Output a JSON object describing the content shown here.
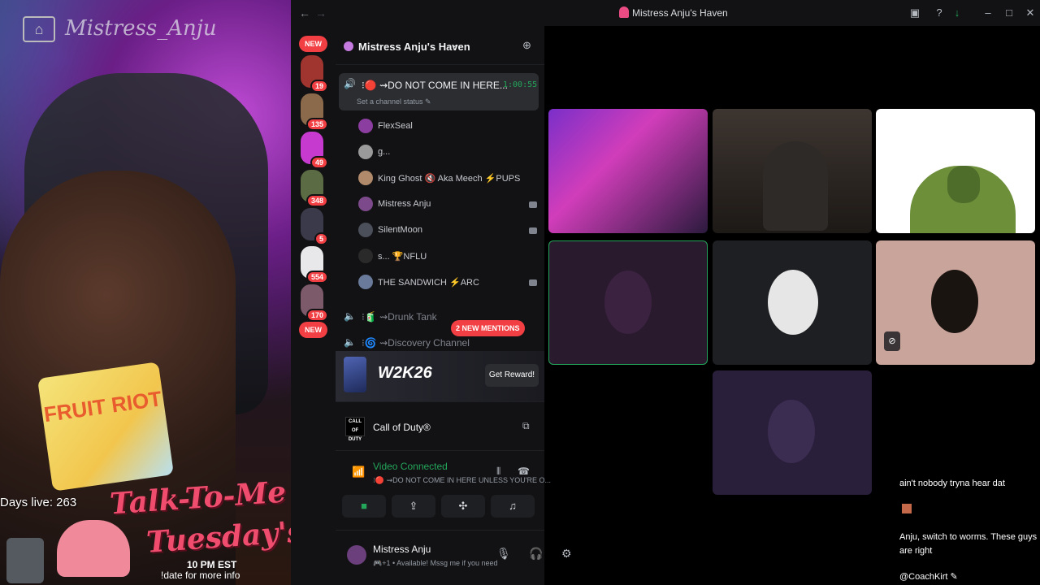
{
  "overlay": {
    "watermark": "Mistress_Anju",
    "days_live_label": "Days live: 263",
    "event_line1": "Talk-To-Me",
    "event_line2": "Tuesday's",
    "event_time": "10 PM EST",
    "event_cmd": "!date for more info",
    "chips_text": "FRUIT RIOT"
  },
  "titlebar": {
    "title": "Mistress Anju's Haven",
    "back_glyph": "←",
    "forward_glyph": "→"
  },
  "servers": [
    {
      "badge": "19",
      "color": "#a0352f"
    },
    {
      "badge": "135",
      "color": "#8b6a4c"
    },
    {
      "badge": "49",
      "color": "#c63ad0"
    },
    {
      "badge": "348",
      "color": "#5b6b44"
    },
    {
      "badge": "5",
      "color": "#3a3a4a"
    },
    {
      "badge": "554",
      "color": "#e8e8ea"
    },
    {
      "badge": "170",
      "color": "#7c5a6a"
    }
  ],
  "server_pills": {
    "new_top": "NEW",
    "new_bottom": "NEW"
  },
  "guild": {
    "name": "Mistress Anju's Haven",
    "chevron": "⌄"
  },
  "active_channel": {
    "name": "⁝🔴 ⇝DO NOT COME IN HERE...",
    "timer": "1:00:55",
    "status": "Set a channel status ✎"
  },
  "members": [
    {
      "name": "FlexSeal",
      "color": "#8b3da0"
    },
    {
      "name": "g...",
      "color": "#9a9a9a"
    },
    {
      "name": "King Ghost 🔇 Aka Meech ⚡PUPS",
      "color": "#b08a6a"
    },
    {
      "name": "Mistress Anju",
      "color": "#7c4a8a"
    },
    {
      "name": "SilentMoon",
      "color": "#4a4f5a"
    },
    {
      "name": "s... 🏆NFLU",
      "color": "#2a2a2a"
    },
    {
      "name": "THE SANDWICH ⚡ARC",
      "color": "#6a7a9a"
    }
  ],
  "other_channels": [
    {
      "name": "⁝🧃 ⇝Drunk Tank"
    },
    {
      "name": "⁝🌀 ⇝Discovery Channel"
    }
  ],
  "new_mentions": "2 NEW MENTIONS",
  "promo": {
    "game": "W2K26",
    "button": "Get Reward!"
  },
  "activity": {
    "game": "Call of Duty®",
    "icon_text": "CALL OF DUTY"
  },
  "voice": {
    "status": "Video Connected",
    "channel": "⁝🔴 ⇝DO NOT COME IN HERE UNLESS YOU'RE O..."
  },
  "user": {
    "name": "Mistress Anju",
    "status": "🎮+1 • Available! Mssg me if you need"
  },
  "chat": {
    "messages": [
      {
        "user": "",
        "text": "ain't nobody tryna hear dat"
      },
      {
        "user": "",
        "text": ""
      },
      {
        "user": "",
        "text": "Anju, switch to worms. These guys are right"
      },
      {
        "user": "",
        "text": "@CoachKirt ✎"
      }
    ]
  },
  "colors": {
    "accent_green": "#23a55a",
    "mention_red": "#f23f43",
    "panel_bg": "#121214"
  }
}
